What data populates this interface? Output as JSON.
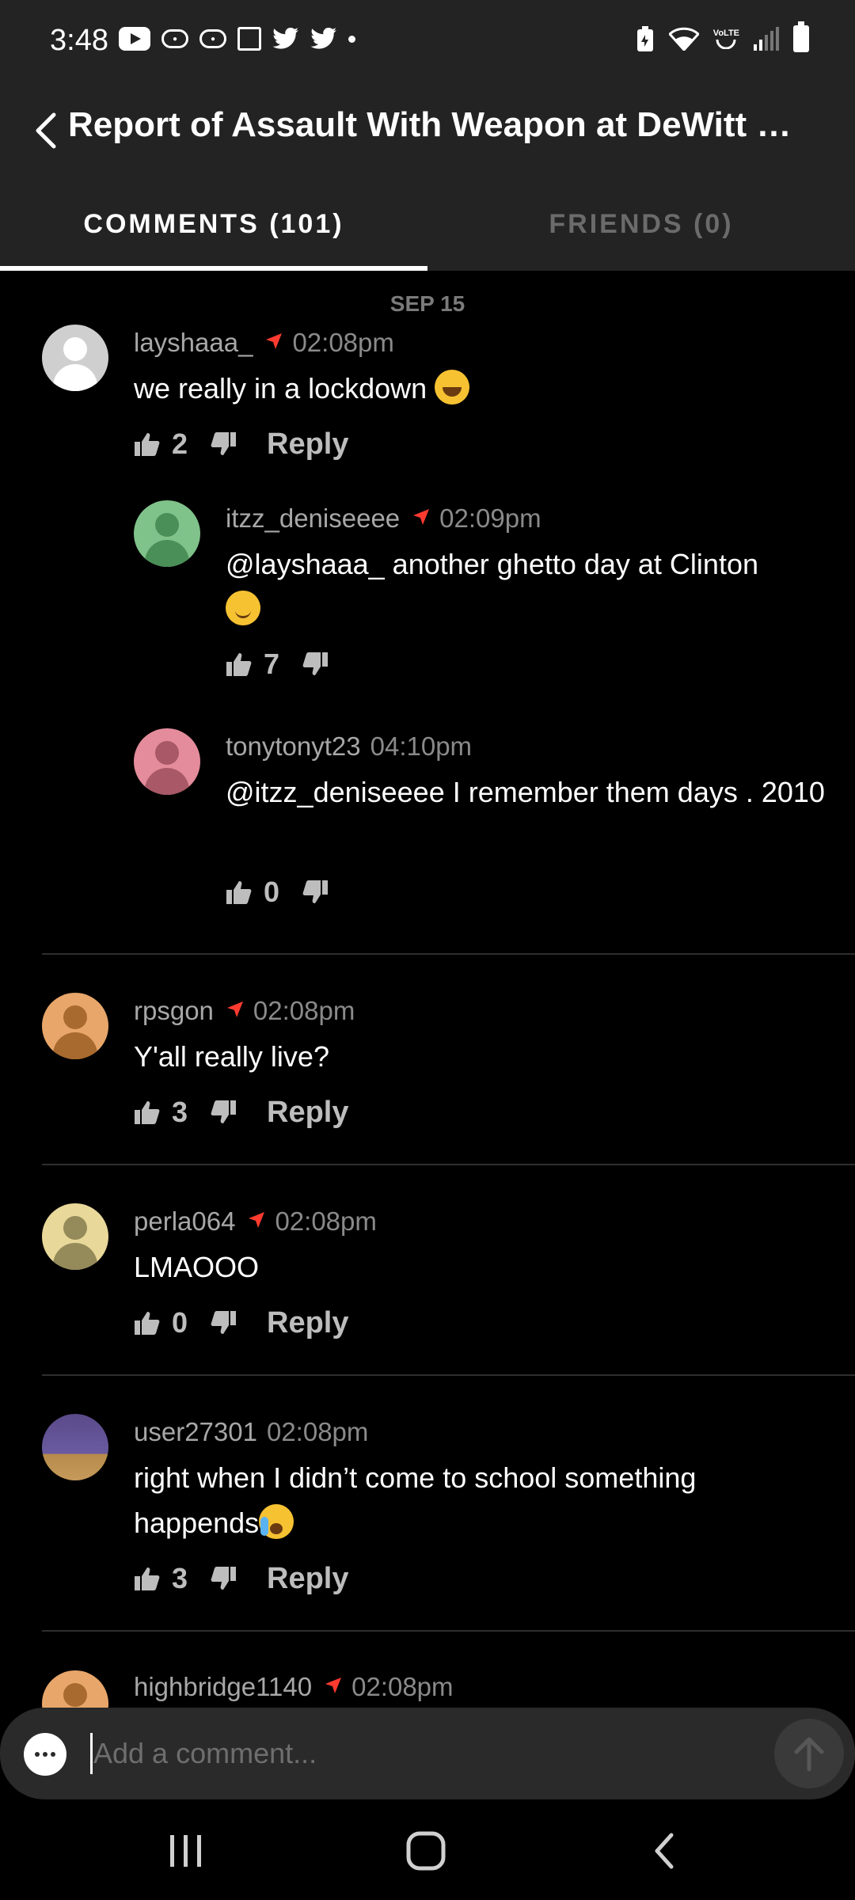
{
  "status_bar": {
    "time": "3:48",
    "left_icons": [
      "youtube-icon",
      "cnn-icon",
      "cnn-icon",
      "news-icon",
      "twitter-icon",
      "twitter-icon",
      "dot-icon"
    ],
    "right_icons": [
      "battery-saver-icon",
      "wifi-icon",
      "volte-icon",
      "signal-icon",
      "battery-icon"
    ],
    "volte_label": "VoLTE"
  },
  "header": {
    "title": "Report of Assault With Weapon at DeWitt Cl...",
    "back_icon": "chevron-left-icon"
  },
  "tabs": [
    {
      "label": "COMMENTS (101)",
      "active": true
    },
    {
      "label": "FRIENDS (0)",
      "active": false
    }
  ],
  "feed": {
    "date_label": "SEP 15",
    "comments": [
      {
        "user": "layshaaa_",
        "time": "02:08pm",
        "text": "we really in a lockdown ",
        "emoji": "laugh",
        "likes": "2",
        "reply_label": "Reply",
        "avatar_color": "#cfcfcf",
        "location": true
      },
      {
        "user": "itzz_deniseeee",
        "time": "02:09pm",
        "text": "@layshaaa_ another ghetto day at Clinton",
        "emoji": "smile",
        "likes": "7",
        "avatar_color": "#7fc28a",
        "location": true
      },
      {
        "user": "tonytonyt23",
        "time": "04:10pm",
        "text": "@itzz_deniseeee I remember them days . 2010",
        "likes": "0",
        "avatar_color": "#e48c9c",
        "location": false
      },
      {
        "user": "rpsgon",
        "time": "02:08pm",
        "text": "Y'all really live?",
        "likes": "3",
        "reply_label": "Reply",
        "avatar_color": "#e8a66a",
        "location": true
      },
      {
        "user": "perla064",
        "time": "02:08pm",
        "text": "LMAOOO",
        "likes": "0",
        "reply_label": "Reply",
        "avatar_color": "#e8d89a",
        "location": true
      },
      {
        "user": "user27301",
        "time": "02:08pm",
        "text": "right when I didn’t come to school something happends",
        "emoji": "cry",
        "likes": "3",
        "reply_label": "Reply",
        "avatar_color": "#5a4a8a",
        "location": false
      },
      {
        "user": "highbridge1140",
        "time": "02:08pm",
        "avatar_color": "#e8a66a",
        "location": true
      }
    ]
  },
  "composer": {
    "placeholder": "Add a comment...",
    "chat_icon": "chat-bubble-icon",
    "send_icon": "arrow-up-icon"
  },
  "nav_bar": {
    "icons": [
      "recent-apps-icon",
      "home-icon",
      "back-icon"
    ]
  },
  "colors": {
    "background": "#000000",
    "header_bg": "#232323",
    "location_arrow": "#ff3b30",
    "muted_text": "#a7a7a7"
  }
}
